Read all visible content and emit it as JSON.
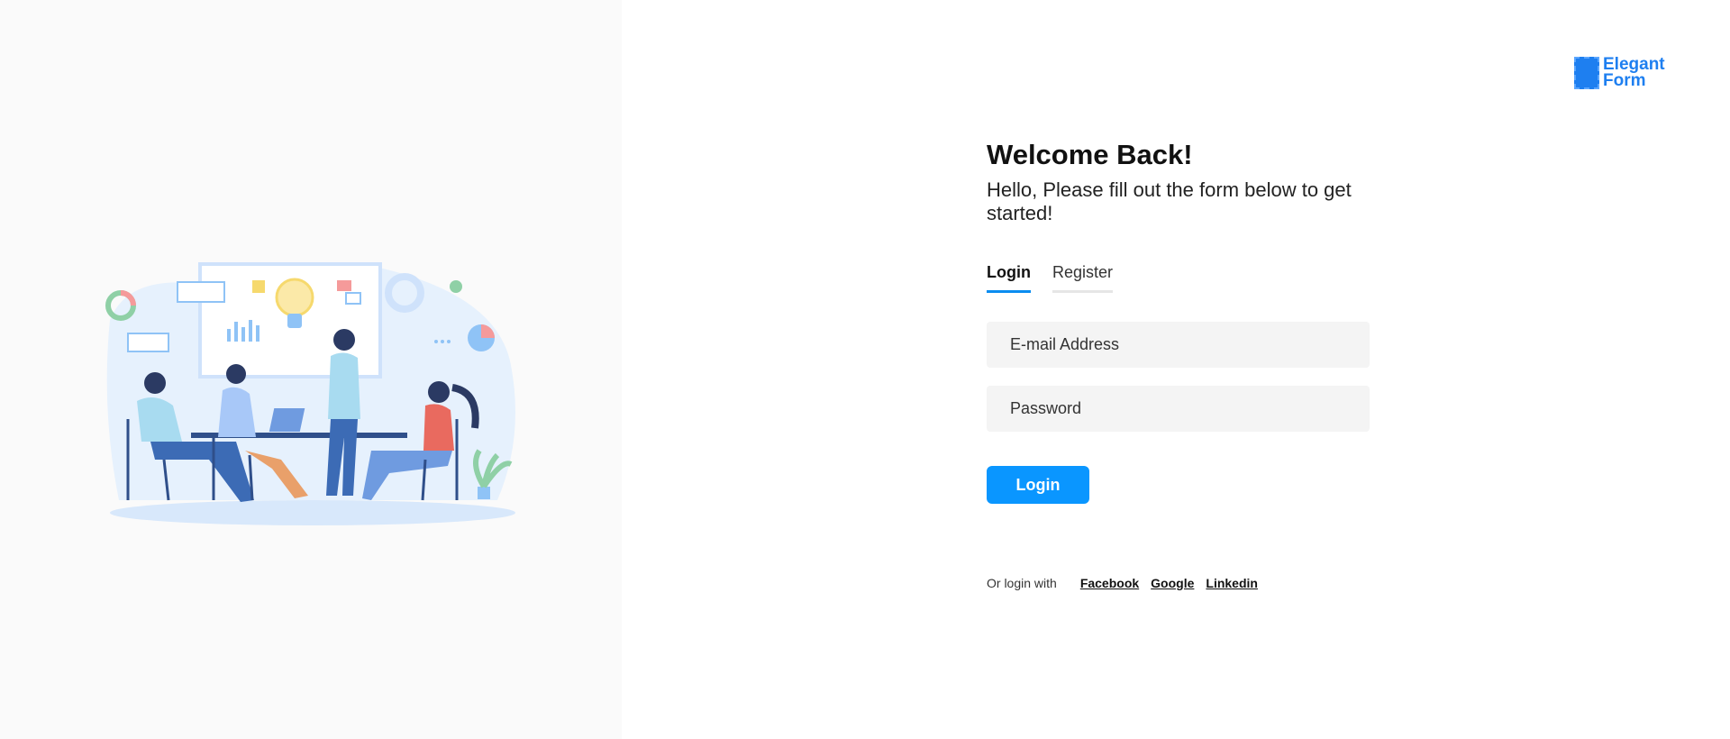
{
  "brand": {
    "logo_line1": "Elegant",
    "logo_line2": "Form",
    "color": "#1e7ff0"
  },
  "form": {
    "title": "Welcome Back!",
    "subtitle": "Hello, Please fill out the form below to get started!",
    "tabs": [
      {
        "label": "Login",
        "active": true
      },
      {
        "label": "Register",
        "active": false
      }
    ],
    "email_placeholder": "E-mail Address",
    "password_placeholder": "Password",
    "submit_label": "Login",
    "accent_color": "#0a96ff"
  },
  "social": {
    "prompt": "Or login with",
    "providers": [
      "Facebook",
      "Google",
      "Linkedin"
    ]
  },
  "illustration": {
    "icon": "team-meeting-illustration"
  }
}
